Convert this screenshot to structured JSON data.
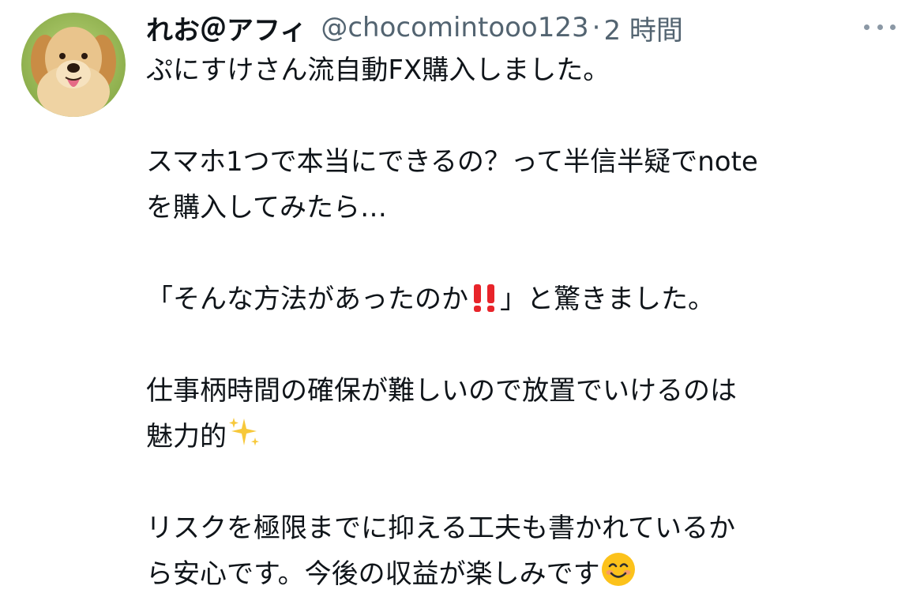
{
  "tweet": {
    "display_name": "れお＠アフィ",
    "handle": "@chocomintooo123",
    "separator": "·",
    "time": "2 時間",
    "more_icon": "ellipsis-icon",
    "avatar_icon": "dog-avatar",
    "text": {
      "line1": "ぷにすけさん流自動FX購入しました。",
      "line2": "スマホ1つで本当にできるの？って半信半疑でnote",
      "line3": "を購入してみたら…",
      "line4a": "「そんな方法があったのか",
      "line4_emoji": "‼️",
      "line4b": "」と驚きました。",
      "line5": "仕事柄時間の確保が難しいので放置でいけるのは",
      "line6a": "魅力的",
      "line6_emoji": "✨",
      "line7": "リスクを極限までに抑える工夫も書かれているか",
      "line8a": "ら安心です。今後の収益が楽しみです",
      "line8_emoji": "😊"
    }
  },
  "colors": {
    "text_primary": "#0f1419",
    "text_secondary": "#536471",
    "exclaim_red": "#e8242a",
    "sparkle_yellow": "#f7c83a",
    "smile_yellow": "#fcc21b"
  }
}
